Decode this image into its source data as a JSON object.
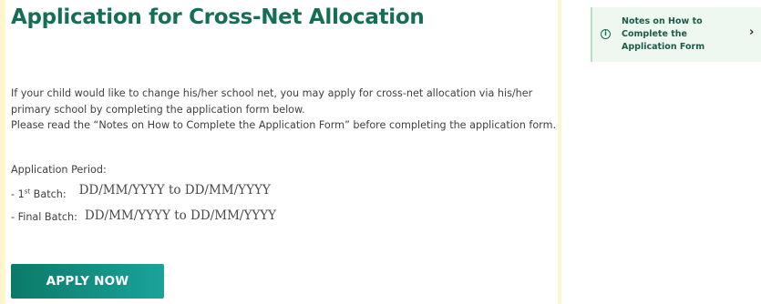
{
  "main": {
    "title": "Application for Cross-Net Allocation",
    "intro_p1": "If your child would like to change his/her school net, you may apply for cross-net allocation via his/her primary school by completing the application form below.",
    "intro_p2": "Please read the “Notes on How to Complete the Application Form” before completing the application form.",
    "period_label": "Application Period:",
    "batches": [
      {
        "label_prefix": "- 1",
        "label_sup": "st",
        "label_suffix": " Batch:",
        "dates": "DD/MM/YYYY to DD/MM/YYYY"
      },
      {
        "label": "- Final Batch:",
        "dates": "DD/MM/YYYY to DD/MM/YYYY"
      }
    ],
    "apply_label": "APPLY NOW"
  },
  "sidebar": {
    "notes_card": {
      "icon": "info-icon",
      "label": "Notes on How to Complete the Application Form",
      "chevron": "chevron-right-icon"
    }
  },
  "colors": {
    "page_bg": "#fff6cf",
    "title": "#146f55",
    "button_start": "#0b7a68",
    "button_end": "#1aa39b",
    "notes_bg": "#eef7f0"
  }
}
